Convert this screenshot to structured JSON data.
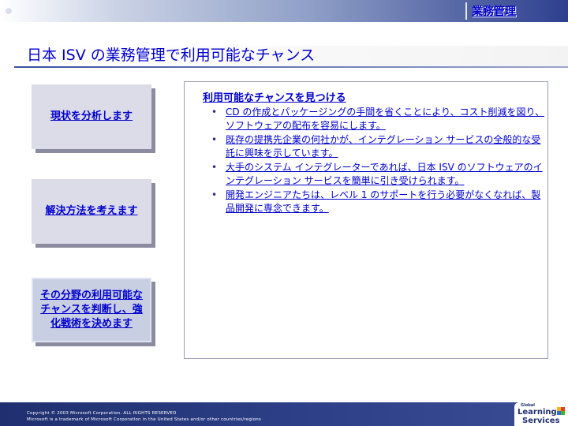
{
  "header": {
    "section_label": "業務管理"
  },
  "title": "日本 ISV の業務管理で利用可能なチャンス",
  "steps": [
    {
      "label": "現状を分析します"
    },
    {
      "label": "解決方法を考えます"
    },
    {
      "label": "その分野の利用可能なチャンスを判断し、強化戦術を決めます"
    }
  ],
  "panel": {
    "heading": "利用可能なチャンスを見つける",
    "bullet_glyph": "•",
    "bullets": [
      "CD の作成とパッケージングの手間を省くことにより、コスト削減を図り、ソフトウェアの配布を容易にします。",
      "既存の提携先企業の何社かが、インテグレーション サービスの全般的な受託に興味を示しています。",
      "大手のシステム インテグレーターであれば、日本 ISV のソフトウェアのインテグレーション サービスを簡単に引き受けられます。",
      "開発エンジニアたちは、レベル 1 のサポートを行う必要がなくなれば、製品開発に専念できます。"
    ]
  },
  "footer": {
    "copyright": "Copyright © 2003 Microsoft Corporation. ALL RIGHTS RESERVED",
    "trademark": "Microsoft is a trademark of Microsoft Corporation in the United States and/or other countries/regions"
  },
  "logo": {
    "line1": "Global",
    "line2": "Learning",
    "line3": "Services"
  }
}
